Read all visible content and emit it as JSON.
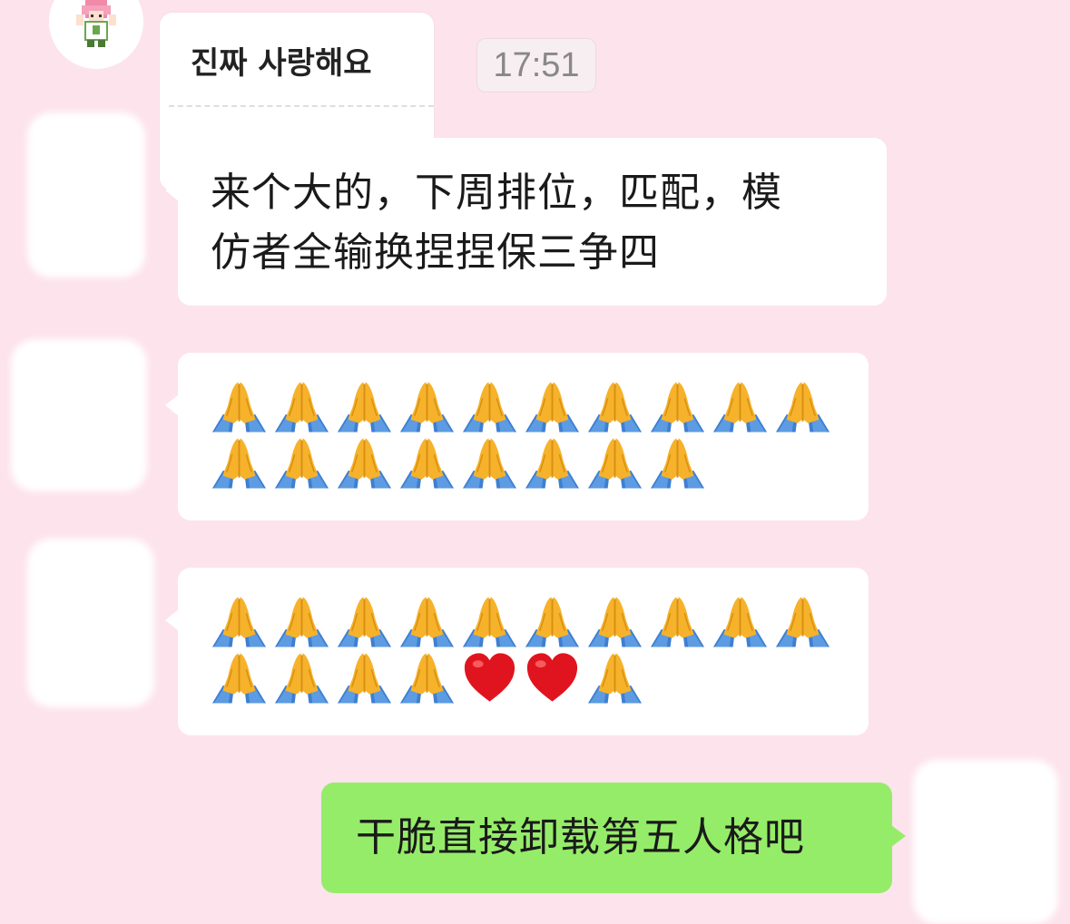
{
  "contact_card": {
    "title": "진짜 사랑해요"
  },
  "timestamp": "17:51",
  "messages": [
    {
      "sender": "other",
      "text_line1": "来个大的，下周排位，匹配，模",
      "text_line2": "仿者全输换捏捏保三争四"
    },
    {
      "sender": "other",
      "emoji_rows": [
        [
          "praying-hands-icon",
          "praying-hands-icon",
          "praying-hands-icon",
          "praying-hands-icon",
          "praying-hands-icon",
          "praying-hands-icon",
          "praying-hands-icon",
          "praying-hands-icon",
          "praying-hands-icon",
          "praying-hands-icon"
        ],
        [
          "praying-hands-icon",
          "praying-hands-icon",
          "praying-hands-icon",
          "praying-hands-icon",
          "praying-hands-icon",
          "praying-hands-icon",
          "praying-hands-icon",
          "praying-hands-icon"
        ]
      ]
    },
    {
      "sender": "other",
      "emoji_rows": [
        [
          "praying-hands-icon",
          "praying-hands-icon",
          "praying-hands-icon",
          "praying-hands-icon",
          "praying-hands-icon",
          "praying-hands-icon",
          "praying-hands-icon",
          "praying-hands-icon",
          "praying-hands-icon",
          "praying-hands-icon"
        ],
        [
          "praying-hands-icon",
          "praying-hands-icon",
          "praying-hands-icon",
          "praying-hands-icon",
          "red-heart-icon",
          "red-heart-icon",
          "praying-hands-icon"
        ]
      ]
    },
    {
      "sender": "me",
      "text": "干脆直接卸载第五人格吧"
    }
  ],
  "colors": {
    "background": "#fde3ec",
    "incoming_bubble": "#ffffff",
    "outgoing_bubble": "#95ec69",
    "heart": "#e0141e",
    "praying_hands": "#f6b22a",
    "sleeve": "#3e7fd1"
  }
}
